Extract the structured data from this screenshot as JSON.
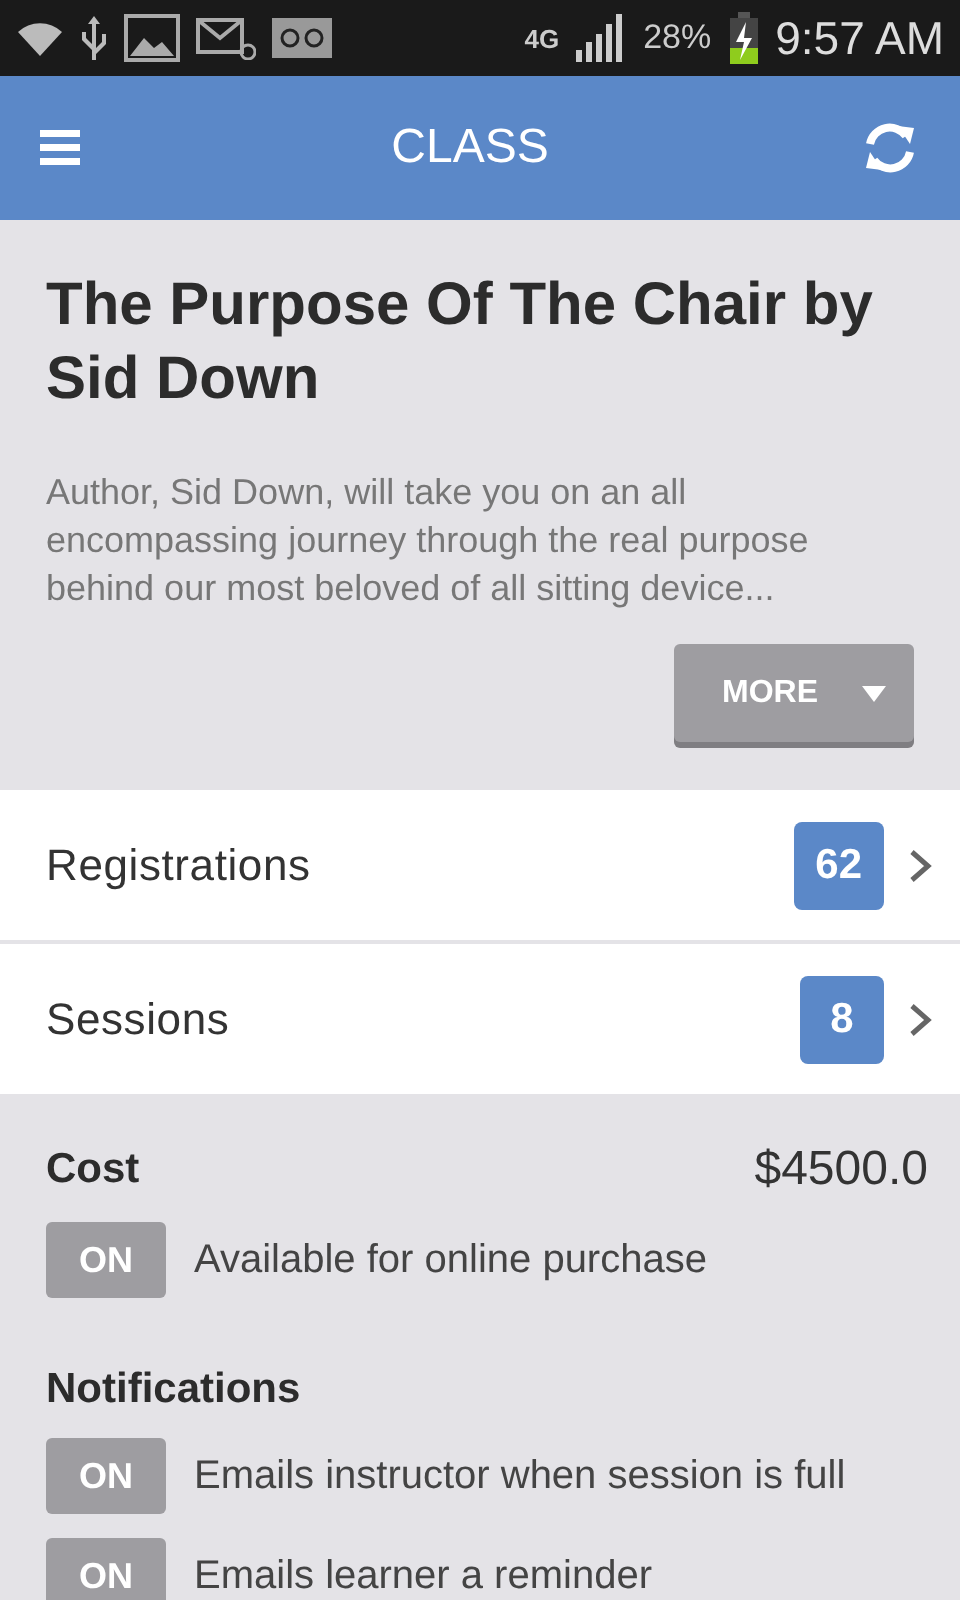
{
  "status_bar": {
    "network": "4G",
    "battery": "28%",
    "time": "9:57 AM"
  },
  "app_bar": {
    "title": "CLASS"
  },
  "class": {
    "title": "The Purpose Of The Chair by Sid Down",
    "description": "Author, Sid Down, will take you on an all encompassing journey through the real purpose behind our most beloved of all sitting device...",
    "more_button": "MORE"
  },
  "links": [
    {
      "label": "Registrations",
      "count": "62"
    },
    {
      "label": "Sessions",
      "count": "8"
    }
  ],
  "cost": {
    "label": "Cost",
    "value": "$4500.0",
    "toggle": {
      "label": "ON",
      "on": true
    },
    "description": "Available for online purchase"
  },
  "notifications": {
    "label": "Notifications",
    "items": [
      {
        "toggle": "ON",
        "on": true,
        "description": "Emails instructor when session is full"
      },
      {
        "toggle": "ON",
        "on": true,
        "description": "Emails learner a reminder"
      }
    ]
  }
}
